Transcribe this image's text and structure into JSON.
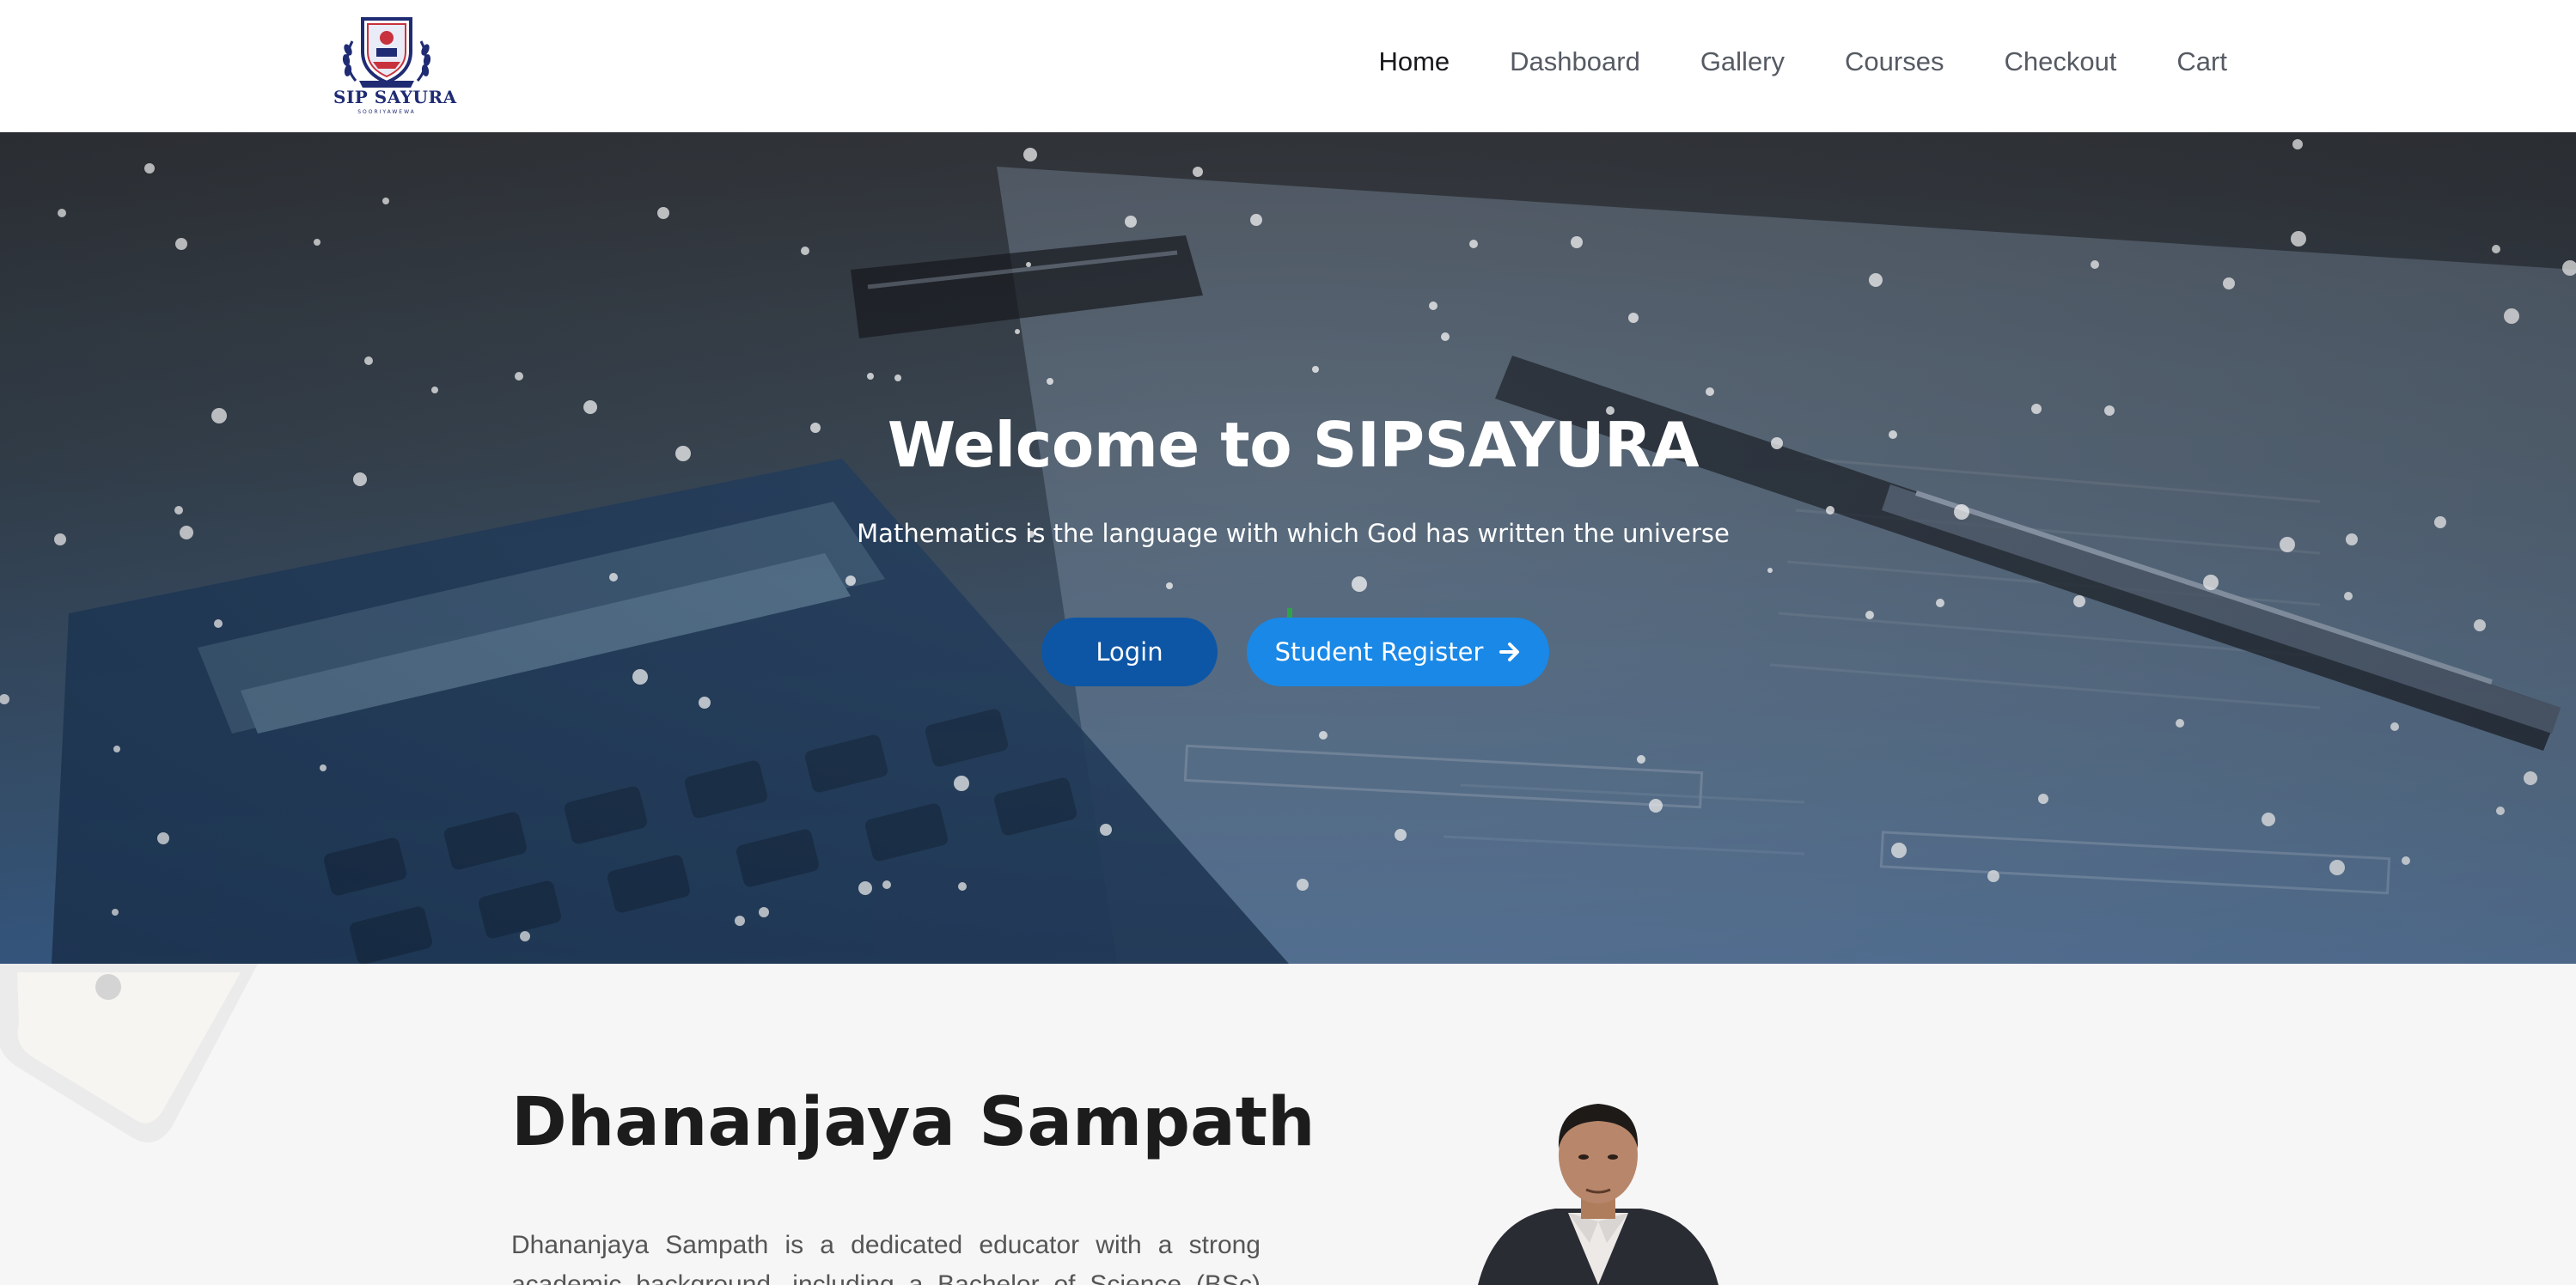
{
  "brand": {
    "name": "SIP SAYURA",
    "tagline": "SOORIYAWEWA"
  },
  "nav": {
    "items": [
      {
        "label": "Home",
        "active": true
      },
      {
        "label": "Dashboard",
        "active": false
      },
      {
        "label": "Gallery",
        "active": false
      },
      {
        "label": "Courses",
        "active": false
      },
      {
        "label": "Checkout",
        "active": false
      },
      {
        "label": "Cart",
        "active": false
      }
    ]
  },
  "hero": {
    "title": "Welcome to SIPSAYURA",
    "subtitle": "Mathematics is the language with which God has written the universe",
    "login_label": "Login",
    "register_label": "Student Register",
    "register_icon": "arrow-right-icon"
  },
  "about": {
    "name": "Dhananjaya Sampath",
    "bio": "Dhananjaya Sampath is a dedicated educator with a strong academic background, including a Bachelor of Science (BSc) degree"
  },
  "colors": {
    "login_button": "#0d56a6",
    "register_button": "#1a88e6",
    "logo_navy": "#1f2b73",
    "logo_red": "#c8323c"
  }
}
